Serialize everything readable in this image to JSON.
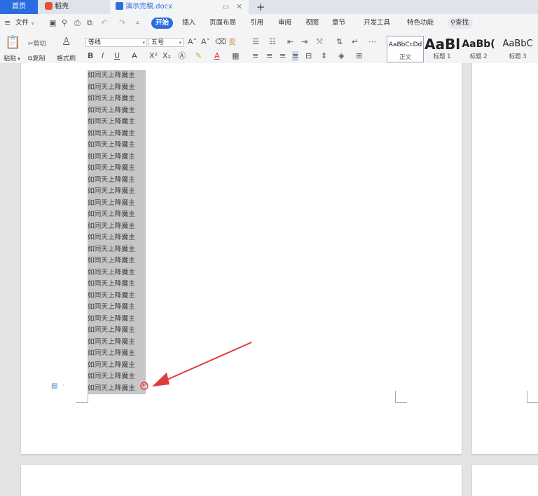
{
  "tabs": {
    "home": "首页",
    "daoke": "稻壳",
    "document": "演示完稿.docx",
    "doc_actions": [
      "▭",
      "✕"
    ],
    "add": "+"
  },
  "menu": {
    "file": "文件",
    "items": [
      "开始",
      "插入",
      "页面布局",
      "引用",
      "审阅",
      "视图",
      "章节",
      "开发工具",
      "特色功能"
    ],
    "search": "查找",
    "hamburger": "≡",
    "quick_access_icons": [
      "save-icon",
      "export-pdf-icon",
      "print-icon",
      "print-preview-icon",
      "undo-icon",
      "redo-icon",
      "customize-icon"
    ]
  },
  "ribbon": {
    "paste": "粘贴",
    "cut": "剪切",
    "copy": "复制",
    "format_painter": "格式刷",
    "font_name": "等线",
    "font_size": "五号",
    "bold": "B",
    "italic": "I",
    "underline": "U",
    "styles": [
      {
        "sample": "AaBbCcDd",
        "caption": "正文"
      },
      {
        "sample": "AaBl",
        "caption": "标题 1"
      },
      {
        "sample": "AaBb(",
        "caption": "标题 2"
      },
      {
        "sample": "AaBbC",
        "caption": "标题 3"
      }
    ]
  },
  "document": {
    "lines": [
      "如同天上降魔主",
      "如同天上降魔主",
      "如同天上降魔主",
      "如同天上降魔主",
      "如同天上降魔主",
      "如同天上降魔主",
      "如同天上降魔主",
      "如同天上降魔主",
      "如同天上降魔主",
      "如同天上降魔主",
      "如同天上降魔主",
      "如同天上降魔主",
      "如同天上降魔主",
      "如同天上降魔主",
      "如同天上降魔主",
      "如同天上降魔主",
      "如同天上降魔主",
      "如同天上降魔主",
      "如同天上降魔主",
      "如同天上降魔主",
      "如同天上降魔主",
      "如同天上降魔主",
      "如同天上降魔主",
      "如同天上降魔主",
      "如同天上降魔主",
      "如同天上降魔主",
      "如同天上降魔主",
      "如同天上降魔主"
    ],
    "paragraph_mark": "↵"
  },
  "colors": {
    "accent": "#2b6de0",
    "selection": "#c6c6c6",
    "arrow": "#e03b3b"
  }
}
